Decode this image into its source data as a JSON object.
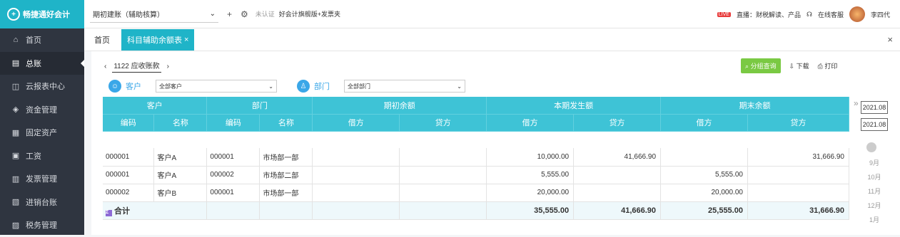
{
  "app": {
    "brand": "畅捷通好会计",
    "brand_icon": "logo-icon"
  },
  "sidebar": {
    "items": [
      {
        "label": "首页",
        "icon": "home-icon"
      },
      {
        "label": "总账",
        "icon": "ledger-icon"
      },
      {
        "label": "云报表中心",
        "icon": "chart-icon"
      },
      {
        "label": "资金管理",
        "icon": "fund-icon"
      },
      {
        "label": "固定资产",
        "icon": "asset-icon"
      },
      {
        "label": "工资",
        "icon": "salary-icon"
      },
      {
        "label": "发票管理",
        "icon": "invoice-icon"
      },
      {
        "label": "进销台账",
        "icon": "stock-icon"
      },
      {
        "label": "税务管理",
        "icon": "tax-icon"
      }
    ]
  },
  "topbar": {
    "account_select": "期初建账（辅助核算）",
    "cert_text": "未认证",
    "cert_link": "好会计旗舰版+发票夹",
    "live_badge": "LIVE",
    "live_text": "直播：财税解读、产品",
    "service": "在线客服",
    "user": "李四代"
  },
  "tabs": {
    "home": "首页",
    "active": "科目辅助余额表"
  },
  "toolbar": {
    "account": "1122 应收账款",
    "group_query": "分组查询",
    "download": "下载",
    "print": "打印"
  },
  "filters": {
    "customer_label": "客户",
    "customer_value": "全部客户",
    "dept_label": "部门",
    "dept_value": "全部部门"
  },
  "table": {
    "group_headers": [
      "客户",
      "部门",
      "期初余额",
      "本期发生额",
      "期末余额"
    ],
    "sub_headers": [
      "编码",
      "名称",
      "编码",
      "名称",
      "借方",
      "贷方",
      "借方",
      "贷方",
      "借方",
      "贷方"
    ],
    "rows": [
      [
        "000001",
        "客户A",
        "000001",
        "市场部一部",
        "",
        "",
        "10,000.00",
        "41,666.90",
        "",
        "31,666.90"
      ],
      [
        "000001",
        "客户A",
        "000002",
        "市场部二部",
        "",
        "",
        "5,555.00",
        "",
        "5,555.00",
        ""
      ],
      [
        "000002",
        "客户B",
        "000001",
        "市场部一部",
        "",
        "",
        "20,000.00",
        "",
        "20,000.00",
        ""
      ]
    ],
    "total_label": "合计",
    "total": [
      "",
      "",
      "35,555.00",
      "41,666.90",
      "25,555.00",
      "31,666.90"
    ]
  },
  "period": {
    "start": "2021.08",
    "end": "2021.08",
    "months": [
      "9月",
      "10月",
      "11月",
      "12月",
      "1月"
    ]
  }
}
